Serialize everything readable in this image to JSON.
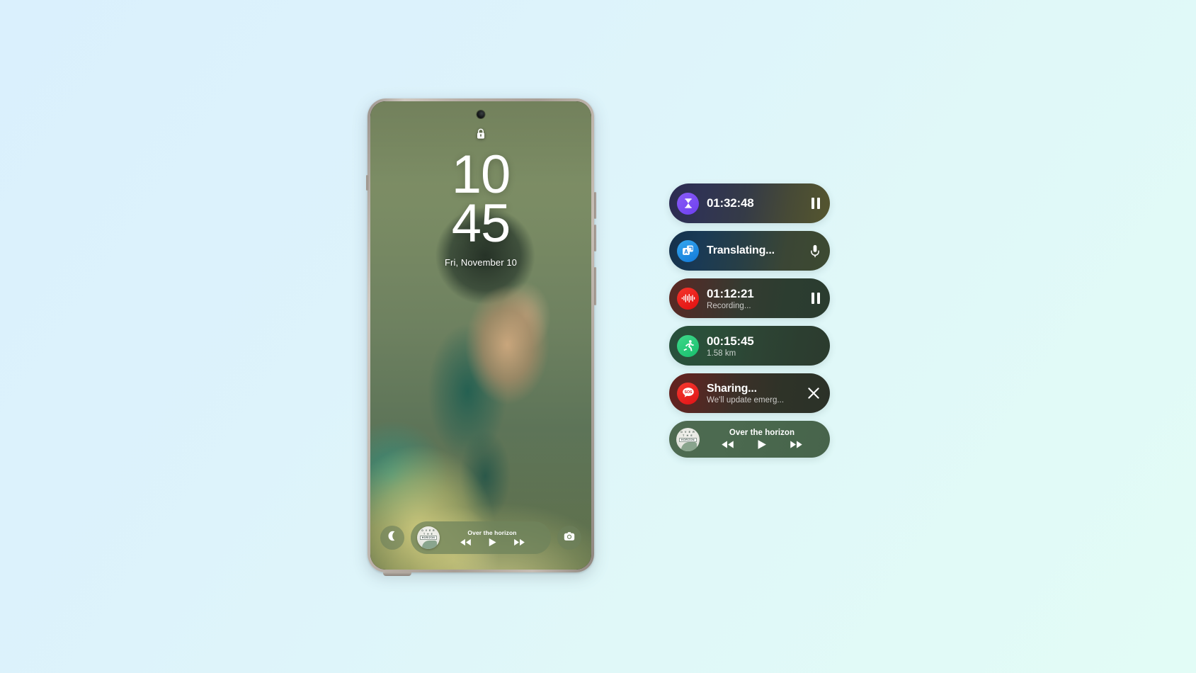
{
  "background": {
    "gradient_from": "#daf0fd",
    "gradient_to": "#e2fcf6"
  },
  "phone": {
    "device_name": "Galaxy smartphone",
    "frame_color": "#b8aea6",
    "lockscreen": {
      "lock_icon_name": "lock-icon",
      "clock_hours": "10",
      "clock_minutes": "45",
      "date": "Fri, November 10",
      "dock": {
        "left_shortcut_name": "phone-icon",
        "right_shortcut_name": "camera-icon",
        "media": {
          "title": "Over the horizon",
          "album_art_line1": "O V E R",
          "album_art_line2": "T H E",
          "album_art_line3": "HORIZON",
          "prev_label": "Previous",
          "play_label": "Play",
          "next_label": "Next"
        }
      }
    }
  },
  "cards": [
    {
      "id": "timer",
      "name": "timer",
      "icon": "hourglass-icon",
      "icon_color": "#7c4df2",
      "title": "01:32:48",
      "subtitle": "",
      "action": "pause-button",
      "bg_from": "#2c2a52",
      "bg_to": "#55562f"
    },
    {
      "id": "translate",
      "name": "translate",
      "icon": "translate-icon",
      "icon_color": "#1d8ae4",
      "title": "Translating...",
      "subtitle": "",
      "action": "microphone-button",
      "bg_from": "#15314b",
      "bg_to": "#3d4a31"
    },
    {
      "id": "recorder",
      "name": "voice-recorder",
      "icon": "waveform-icon",
      "icon_color": "#ea1a16",
      "title": "01:12:21",
      "subtitle": "Recording...",
      "action": "pause-button",
      "bg_from": "#5c2822",
      "bg_to": "#2a3c2f"
    },
    {
      "id": "run",
      "name": "running-workout",
      "icon": "running-icon",
      "icon_color": "#22c777",
      "title": "00:15:45",
      "subtitle": "1.58 km",
      "action": "none",
      "bg_from": "#27503c",
      "bg_to": "#2b3b2e"
    },
    {
      "id": "sos",
      "name": "emergency-sharing",
      "icon": "sos-icon",
      "icon_color": "#e8201c",
      "title": "Sharing...",
      "subtitle": "We'll update emerg...",
      "action": "close-button",
      "bg_from": "#65211f",
      "bg_to": "#2b3128"
    }
  ],
  "media_card": {
    "name": "media-player",
    "title": "Over the horizon",
    "album_art_line1": "O V E R",
    "album_art_line2": "T H E",
    "album_art_line3": "HORIZON",
    "prev_label": "Previous track",
    "play_label": "Play",
    "next_label": "Next track",
    "bg_color": "#4b6950"
  },
  "sos_icon_text": "SOS",
  "translate_icon_text": "A"
}
